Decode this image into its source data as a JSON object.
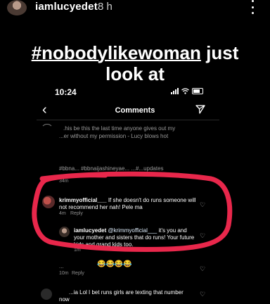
{
  "story": {
    "username": "iamlucyedet",
    "time": "8 h",
    "caption_hashtag": "#nobodylikewoman",
    "caption_rest_line1": " just",
    "caption_line2": "look at"
  },
  "phone": {
    "status_time": "10:24",
    "nav_title": "Comments"
  },
  "comments": {
    "top_line1": ".his be this the last time anyone gives out my",
    "top_line2": "...er without my permission - Lucy blows hot",
    "hashtags": "#bbna...  #bbnaijashineyae...  ...#...updates",
    "hashtags_meta": "34m",
    "krimmy_user": "krimmyofficial___",
    "krimmy_text1": " If she doesn't do runs someone will",
    "krimmy_text2": "not recommend her nah! Pele ma",
    "krimmy_meta_time": "4m",
    "krimmy_meta_reply": "Reply",
    "reply_user": "iamlucyedet",
    "reply_mention": "@krimmyofficial___",
    "reply_text1": " it's you and",
    "reply_text2": "your mother and sisters that do runs! Your future",
    "reply_text3": "kids and grand kids too.",
    "reply_meta": "1m",
    "emoji_user": "...",
    "emoji_text": "😂😂😂😂",
    "emoji_meta_time": "10m",
    "emoji_meta_reply": "Reply",
    "last_text": "...ia Lol I bet runs girls are texting that number",
    "last_text2": "now"
  },
  "colors": {
    "annotation": "#e8274b",
    "muted": "#8e8e8e"
  }
}
